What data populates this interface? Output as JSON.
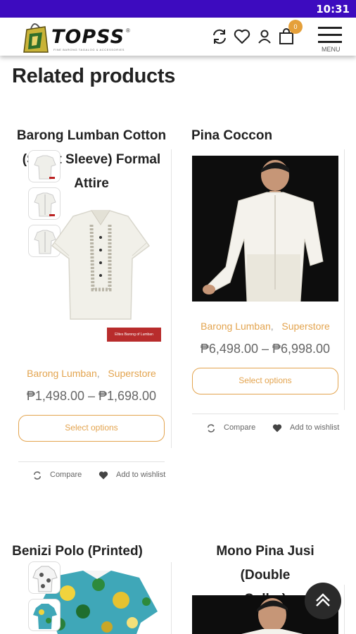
{
  "status_bar": {
    "time": "10:31"
  },
  "header": {
    "logo_text": "TOPSS",
    "logo_tagline": "FINE BARONG TAGALOG & ACCESSORIES",
    "cart_count": "0",
    "menu_label": "MENU"
  },
  "section_title": "Related products",
  "products": [
    {
      "title_lines": [
        "Barong Lumban Cotton",
        "(Short Sleeve) Formal",
        "Attire"
      ],
      "categories": [
        "Barong Lumban",
        "Superstore"
      ],
      "separator": ",",
      "price": "₱1,498.00 – ₱1,698.00",
      "button": "Select options",
      "compare": "Compare",
      "wishlist": "Add to wishlist",
      "label_badge": "Elites Barong of Lumban"
    },
    {
      "title_lines": [
        "Pina Coccon"
      ],
      "categories": [
        "Barong Lumban",
        "Superstore"
      ],
      "separator": ",",
      "price": "₱6,498.00 – ₱6,998.00",
      "button": "Select options",
      "compare": "Compare",
      "wishlist": "Add to wishlist"
    },
    {
      "title_lines": [
        "Benizi Polo (Printed)"
      ]
    },
    {
      "title_lines": [
        "Mono Pina Jusi (Double",
        "Collar)"
      ]
    }
  ],
  "colors": {
    "status_bar": "#3d0bbf",
    "accent": "#e3a44f",
    "cart_badge": "#e5a03a"
  }
}
